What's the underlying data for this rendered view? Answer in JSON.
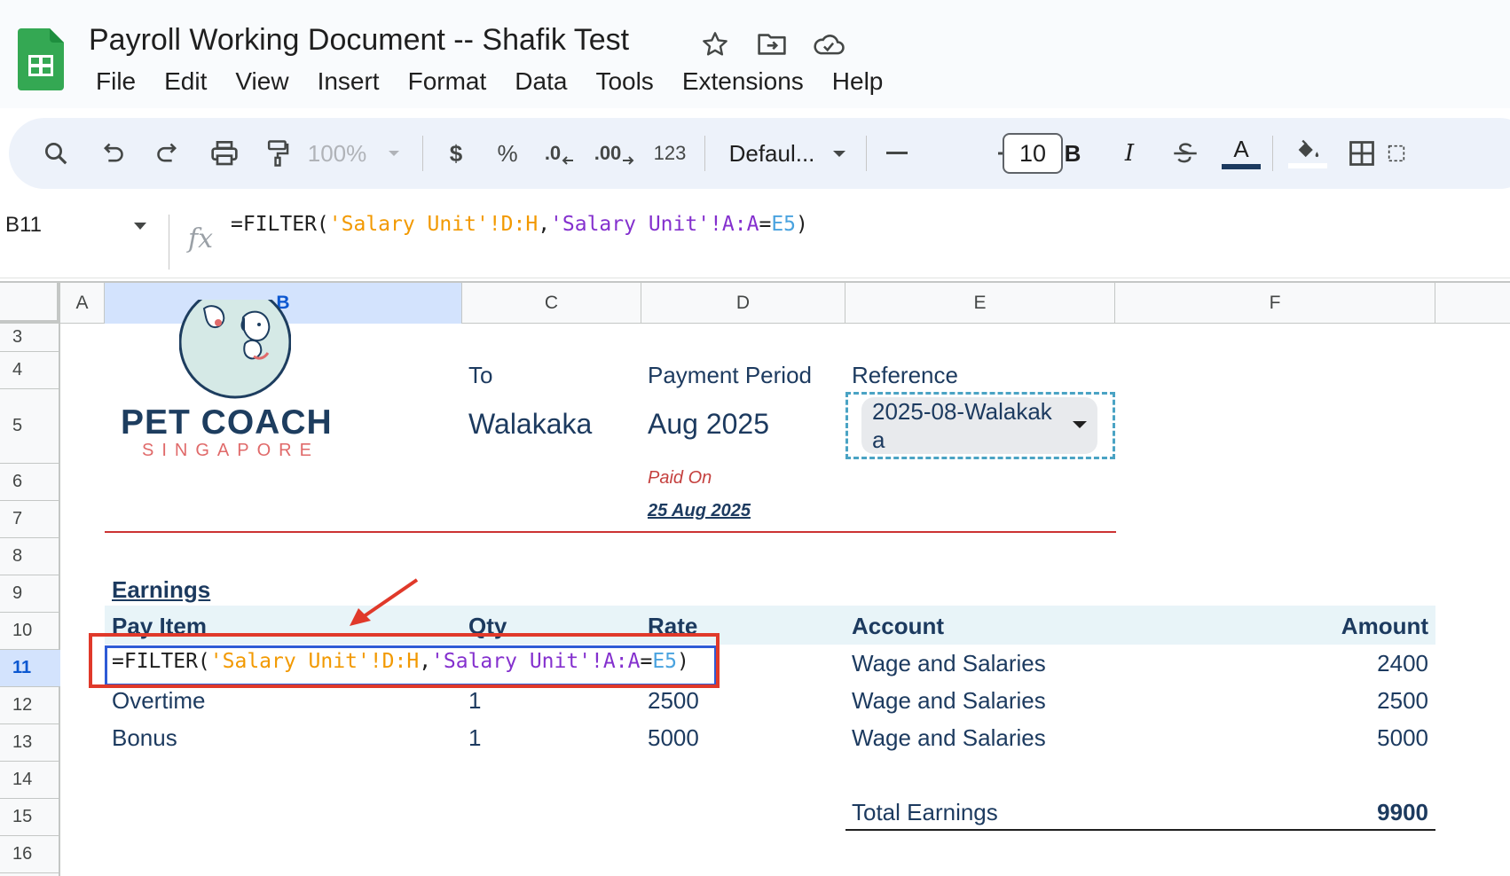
{
  "app": {
    "doc_title": "Payroll Working Document -- Shafik Test",
    "menu": [
      "File",
      "Edit",
      "View",
      "Insert",
      "Format",
      "Data",
      "Tools",
      "Extensions",
      "Help"
    ],
    "icons": [
      "sheets-logo-icon",
      "star-icon",
      "move-folder-icon",
      "cloud-saved-icon"
    ]
  },
  "toolbar": {
    "zoom": "100%",
    "currency": "$",
    "percent": "%",
    "decrease_decimal": ".0",
    "increase_decimal": ".00",
    "number_format": "123",
    "font": "Defaul...",
    "font_size": "10",
    "bold": "B",
    "italic": "I",
    "text_color_letter": "A"
  },
  "formula_bar": {
    "name_box": "B11",
    "fx": "fx",
    "formula_parts": [
      "=FILTER(",
      "'Salary Unit'!D:H",
      ",",
      "'Salary Unit'!A:A",
      "=",
      "E5",
      ")"
    ]
  },
  "grid": {
    "columns": [
      "A",
      "B",
      "C",
      "D",
      "E",
      "F"
    ],
    "rows": [
      "3",
      "4",
      "5",
      "6",
      "7",
      "8",
      "9",
      "10",
      "11",
      "12",
      "13",
      "14",
      "15",
      "16"
    ],
    "active_cell": "B11"
  },
  "invoice": {
    "logo_line1": "PET COACH",
    "logo_line2": "SINGAPORE",
    "to_label": "To",
    "to_value": "Walakaka",
    "period_label": "Payment Period",
    "period_value": "Aug 2025",
    "reference_label": "Reference",
    "reference_value": "2025-08-Walakak a",
    "paid_on_label": "Paid On",
    "paid_on_value": "25 Aug 2025",
    "earnings_title": "Earnings",
    "headers": {
      "pay_item": "Pay Item",
      "qty": "Qty",
      "rate": "Rate",
      "account": "Account",
      "amount": "Amount"
    },
    "rows": [
      {
        "pay_item": "",
        "qty": "",
        "rate": "",
        "account": "Wage and Salaries",
        "amount": "2400"
      },
      {
        "pay_item": "Overtime",
        "qty": "1",
        "rate": "2500",
        "account": "Wage and Salaries",
        "amount": "2500"
      },
      {
        "pay_item": "Bonus",
        "qty": "1",
        "rate": "5000",
        "account": "Wage and Salaries",
        "amount": "5000"
      }
    ],
    "total_label": "Total Earnings",
    "total_value": "9900"
  },
  "colors": {
    "accent_blue": "#0b57d0",
    "annotation_red": "#e0392a",
    "navy_text": "#1c3a5f",
    "sheets_green": "#34a853"
  }
}
